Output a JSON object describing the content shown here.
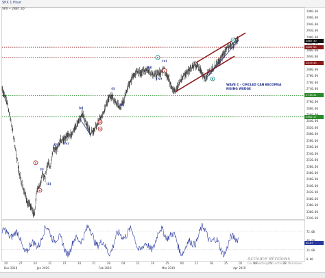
{
  "window": {
    "title": "SPX 1 Hour",
    "legend": "SPX • 2887.30"
  },
  "chart_data": {
    "type": "line",
    "title": "SPX 1 Hour",
    "price_axis": {
      "labels": [
        "2980.00",
        "2960.00",
        "2940.00",
        "2920.00",
        "2900.00",
        "2880.00",
        "2860.00",
        "2840.00",
        "2820.00",
        "2800.00",
        "2780.00",
        "2760.00",
        "2740.00",
        "2720.00",
        "2700.00",
        "2680.00",
        "2660.00",
        "2640.00",
        "2620.00",
        "2600.00",
        "2580.00",
        "2560.00",
        "2540.00",
        "2520.00",
        "2500.00",
        "2480.00",
        "2460.00",
        "2440.00",
        "2420.00",
        "2400.00",
        "2380.00",
        "2360.00",
        "2340.00"
      ],
      "range": [
        2340,
        2980
      ]
    },
    "oscillator_axis": {
      "labels": [
        "72.00",
        "48.00",
        "24.00",
        "0.00"
      ],
      "range": [
        0,
        96
      ]
    },
    "price_tags": [
      {
        "label": "2887.30",
        "color": "#111111"
      },
      {
        "label": "2867.55",
        "color": "#8b1a1a"
      },
      {
        "label": "2819.43",
        "color": "#8b1a1a"
      },
      {
        "label": "2718.31",
        "color": "#2b8a2b"
      },
      {
        "label": "2652.17",
        "color": "#2b8a2b"
      }
    ],
    "osc_tag": {
      "label": "40.87",
      "color": "#2a3aa0"
    },
    "horizontal_levels": [
      {
        "price": 2867.55,
        "color": "#8b1a1a"
      },
      {
        "price": 2836,
        "color": "#8b1a1a"
      },
      {
        "price": 2718.31,
        "color": "#2b8a2b"
      },
      {
        "price": 2652.17,
        "color": "#2b8a2b"
      }
    ],
    "time_axis": {
      "day_labels": [
        "20",
        "27",
        "24",
        "31",
        "07",
        "14",
        "21",
        "28",
        "04",
        "11",
        "19",
        "25",
        "04",
        "11",
        "18",
        "25",
        "01",
        "08",
        "15",
        "22"
      ],
      "month_labels": [
        "Dec 2018",
        "Jan 2019",
        "Feb 2019",
        "Mar 2019",
        "Apr 2019"
      ]
    },
    "wave_labels": [
      {
        "text": "1",
        "color": "#b01818",
        "circle": true
      },
      {
        "text": "ii",
        "color": "#b01818",
        "circle": true
      },
      {
        "text": "(i)",
        "color": "#1a2a8a",
        "circle": false
      },
      {
        "text": "(ii)",
        "color": "#1a2a8a",
        "circle": false
      },
      {
        "text": "(iii)",
        "color": "#1a2a8a",
        "circle": false
      },
      {
        "text": "(iv)",
        "color": "#1a2a8a",
        "circle": false
      },
      {
        "text": "(v)",
        "color": "#1a2a8a",
        "circle": false
      },
      {
        "text": "iii",
        "color": "#b01818",
        "circle": true
      },
      {
        "text": "iv",
        "color": "#b01818",
        "circle": true
      },
      {
        "text": "(i)",
        "color": "#1a2a8a",
        "circle": false
      },
      {
        "text": "(ii)",
        "color": "#1a2a8a",
        "circle": false
      },
      {
        "text": "(iii)",
        "color": "#1a2a8a",
        "circle": false
      },
      {
        "text": "(iv)",
        "color": "#1a2a8a",
        "circle": false
      },
      {
        "text": "(v)",
        "color": "#1a2a8a",
        "circle": false
      },
      {
        "text": "v",
        "color": "#b01818",
        "circle": true
      },
      {
        "text": "A",
        "color": "#1a8a8a",
        "circle": true
      },
      {
        "text": "B",
        "color": "#1a8a8a",
        "circle": true
      },
      {
        "text": "C",
        "color": "#1a8a8a",
        "circle": true
      }
    ],
    "annotation": [
      "WAVE C - CIRCLED CAN BECOMEA",
      "RISING WEDGE"
    ]
  },
  "watermark": {
    "line1": "Activate Windows",
    "line2": "Go to Settings to activate Windows."
  }
}
